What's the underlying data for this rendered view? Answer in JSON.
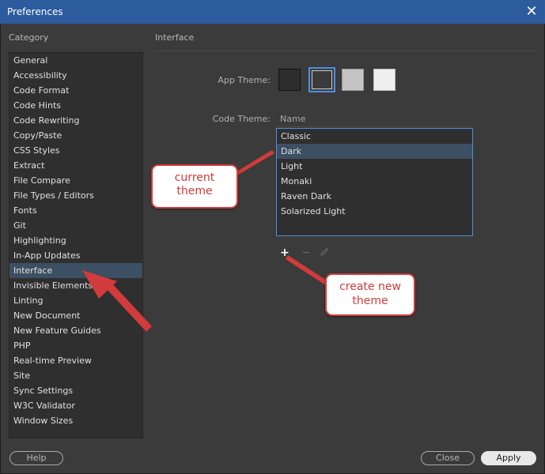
{
  "window": {
    "title": "Preferences"
  },
  "sidebar": {
    "label": "Category",
    "items": [
      {
        "label": "General"
      },
      {
        "label": "Accessibility"
      },
      {
        "label": "Code Format"
      },
      {
        "label": "Code Hints"
      },
      {
        "label": "Code Rewriting"
      },
      {
        "label": "Copy/Paste"
      },
      {
        "label": "CSS Styles"
      },
      {
        "label": "Extract"
      },
      {
        "label": "File Compare"
      },
      {
        "label": "File Types / Editors"
      },
      {
        "label": "Fonts"
      },
      {
        "label": "Git"
      },
      {
        "label": "Highlighting"
      },
      {
        "label": "In-App Updates"
      },
      {
        "label": "Interface",
        "selected": true
      },
      {
        "label": "Invisible Elements"
      },
      {
        "label": "Linting"
      },
      {
        "label": "New Document"
      },
      {
        "label": "New Feature Guides"
      },
      {
        "label": "PHP"
      },
      {
        "label": "Real-time Preview"
      },
      {
        "label": "Site"
      },
      {
        "label": "Sync Settings"
      },
      {
        "label": "W3C Validator"
      },
      {
        "label": "Window Sizes"
      }
    ]
  },
  "panel": {
    "title": "Interface",
    "app_theme": {
      "label": "App Theme:",
      "swatches": [
        {
          "name": "darkest",
          "color": "#2d2d2d",
          "selected": false
        },
        {
          "name": "dark",
          "color": "#3b3b3b",
          "selected": true
        },
        {
          "name": "light",
          "color": "#c4c4c4",
          "selected": false
        },
        {
          "name": "lightest",
          "color": "#efefef",
          "selected": false
        }
      ]
    },
    "code_theme": {
      "label": "Code Theme:",
      "column_header": "Name",
      "items": [
        {
          "label": "Classic"
        },
        {
          "label": "Dark",
          "selected": true
        },
        {
          "label": "Light"
        },
        {
          "label": "Monaki"
        },
        {
          "label": "Raven Dark"
        },
        {
          "label": "Solarized Light"
        }
      ],
      "tools": {
        "add": "+",
        "remove": "−",
        "edit": "pencil-icon"
      }
    }
  },
  "annotations": {
    "current_theme": "current\ntheme",
    "create_new_theme": "create new\ntheme",
    "color": "#d23b3b"
  },
  "footer": {
    "help": "Help",
    "close": "Close",
    "apply": "Apply"
  }
}
